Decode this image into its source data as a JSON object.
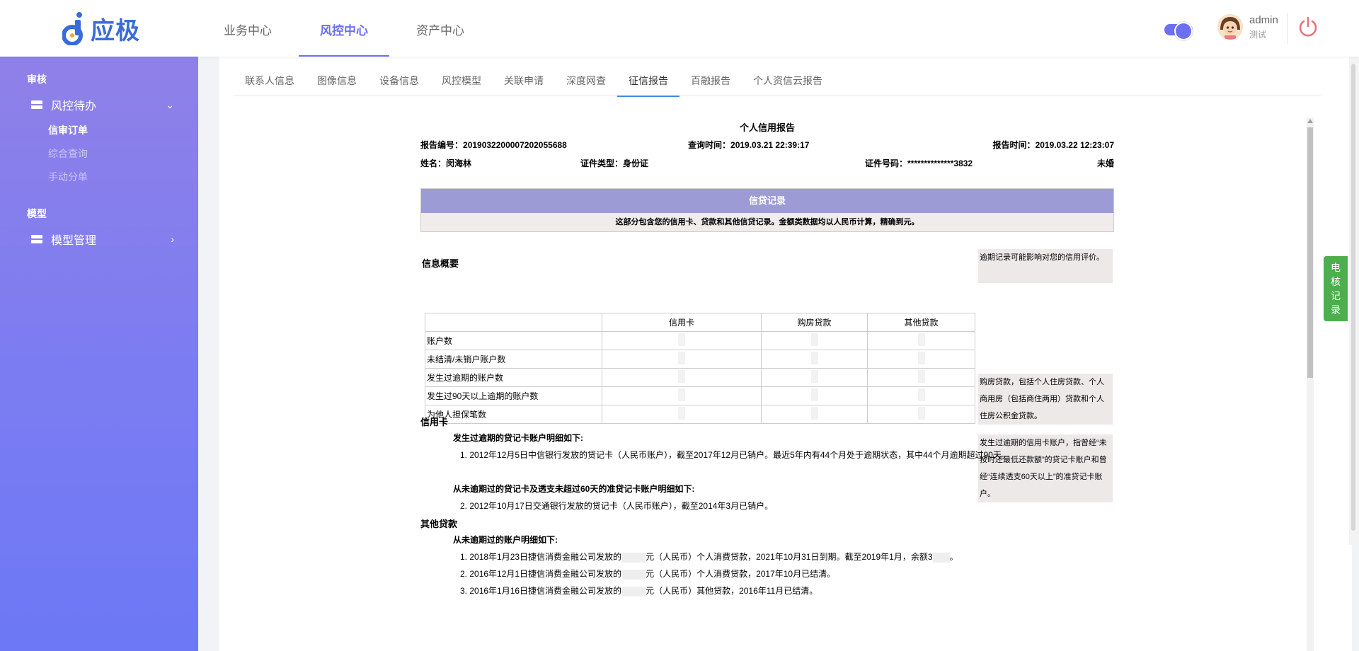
{
  "app": {
    "logo_text": "应极"
  },
  "topnav": [
    {
      "label": "业务中心",
      "active": false
    },
    {
      "label": "风控中心",
      "active": true
    },
    {
      "label": "资产中心",
      "active": false
    }
  ],
  "user": {
    "name": "admin",
    "role": "测试"
  },
  "sidebar": {
    "group1": "审核",
    "item1": "风控待办",
    "subitems": [
      "信审订单",
      "综合查询",
      "手动分单"
    ],
    "group2": "模型",
    "item2": "模型管理"
  },
  "tabs": [
    "联系人信息",
    "图像信息",
    "设备信息",
    "风控模型",
    "关联申请",
    "深度网查",
    "征信报告",
    "百融报告",
    "个人资信云报告"
  ],
  "active_tab": "征信报告",
  "report": {
    "title": "个人信用报告",
    "report_no_label": "报告编号：",
    "report_no": "2019032200007202055688",
    "query_time_label": "查询时间：",
    "query_time": "2019.03.21 22:39:17",
    "report_time_label": "报告时间：",
    "report_time": "2019.03.22 12:23:07",
    "name_label": "姓名：",
    "name": "闵海林",
    "id_type_label": "证件类型：",
    "id_type": "身份证",
    "id_no_label": "证件号码：",
    "id_no": "**************3832",
    "marital": "未婚",
    "credit_head": "信贷记录",
    "credit_sub": "这部分包含您的信用卡、贷款和其他信贷记录。金额类数据均以人民币计算，精确到元。",
    "summary_title": "信息概要",
    "notes": [
      "逾期记录可能影响对您的信用评价。",
      "购房贷款，包括个人住房贷款、个人商用房（包括商住两用）贷款和个人住房公积金贷款。",
      "发生过逾期的信用卡账户，指曾经“未按时还最低还款额”的贷记卡账户和曾经“连续透支60天以上”的准贷记卡账户。"
    ],
    "table": {
      "headers": [
        "信用卡",
        "购房贷款",
        "其他贷款"
      ],
      "rows": [
        "账户数",
        "未结清/未销户账户数",
        "发生过逾期的账户数",
        "发生过90天以上逾期的账户数",
        "为他人担保笔数"
      ]
    },
    "credit_card_title": "信用卡",
    "overdue_title": "发生过逾期的贷记卡账户明细如下:",
    "overdue_item": "1. 2012年12月5日中信银行发放的贷记卡（人民币账户），截至2017年12月已销户。最近5年内有44个月处于逾期状态，其中44个月逾期超过90天。",
    "never_overdue_title": "从未逾期过的贷记卡及透支未超过60天的准贷记卡账户明细如下:",
    "never_overdue_item": "2. 2012年10月17日交通银行发放的贷记卡（人民币账户），截至2014年3月已销户。",
    "other_loan_title": "其他贷款",
    "other_never_title": "从未逾期过的账户明细如下:",
    "loan1_a": "1. 2018年1月23日捷信消费金融公司发放的",
    "loan1_b": "元（人民币）个人消费贷款，2021年10月31日到期。截至2019年1月，余额3",
    "loan1_c": "。",
    "loan2_a": "2. 2016年12月1日捷信消费金融公司发放的",
    "loan2_b": "元（人民币）个人消费贷款，2017年10月已结清。",
    "loan3_a": "3. 2016年1月16日捷信消费金融公司发放的",
    "loan3_b": "元（人民币）其他贷款，2016年11月已结清。"
  },
  "float_tab": "电核记录",
  "colors": {
    "accent": "#6c6ff0",
    "sidebar_top": "#8f80e8",
    "sidebar_bottom": "#6c78f5",
    "credit_head": "#9d9bd6",
    "float_tab": "#4cae4c"
  }
}
